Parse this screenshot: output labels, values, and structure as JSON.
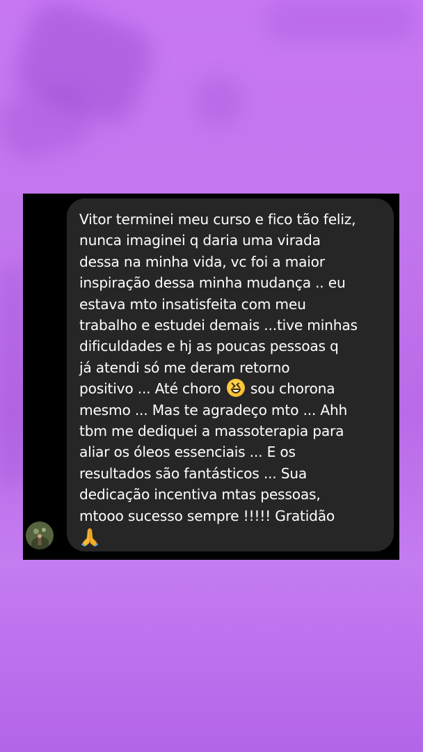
{
  "message": {
    "lines": [
      "Vitor terminei meu curso e fico tão feliz,",
      "nunca imaginei q daria uma virada",
      "dessa na minha vida, vc foi a maior",
      "inspiração dessa minha mudança .. eu",
      "estava mto insatisfeita com meu",
      "trabalho e estudei demais ...tive minhas",
      "dificuldades e hj as poucas pessoas q",
      "já atendi só me deram retorno",
      "positivo ... Até choro",
      "sou chorona",
      "mesmo ... Mas te agradeço mto ... Ahh",
      "tbm me dediquei a massoterapia para",
      "aliar os óleos essenciais ... E os",
      "resultados são fantásticos ... Sua",
      "dedicação incentiva mtas pessoas,",
      "mtooo sucesso sempre !!!!! Gratidão"
    ],
    "emoji_1": "grinning-squinting-face-emoji",
    "emoji_2": "folded-hands-emoji"
  },
  "colors": {
    "background": "#c276ee",
    "panel": "#000000",
    "bubble": "#262626",
    "text": "#ffffff"
  }
}
